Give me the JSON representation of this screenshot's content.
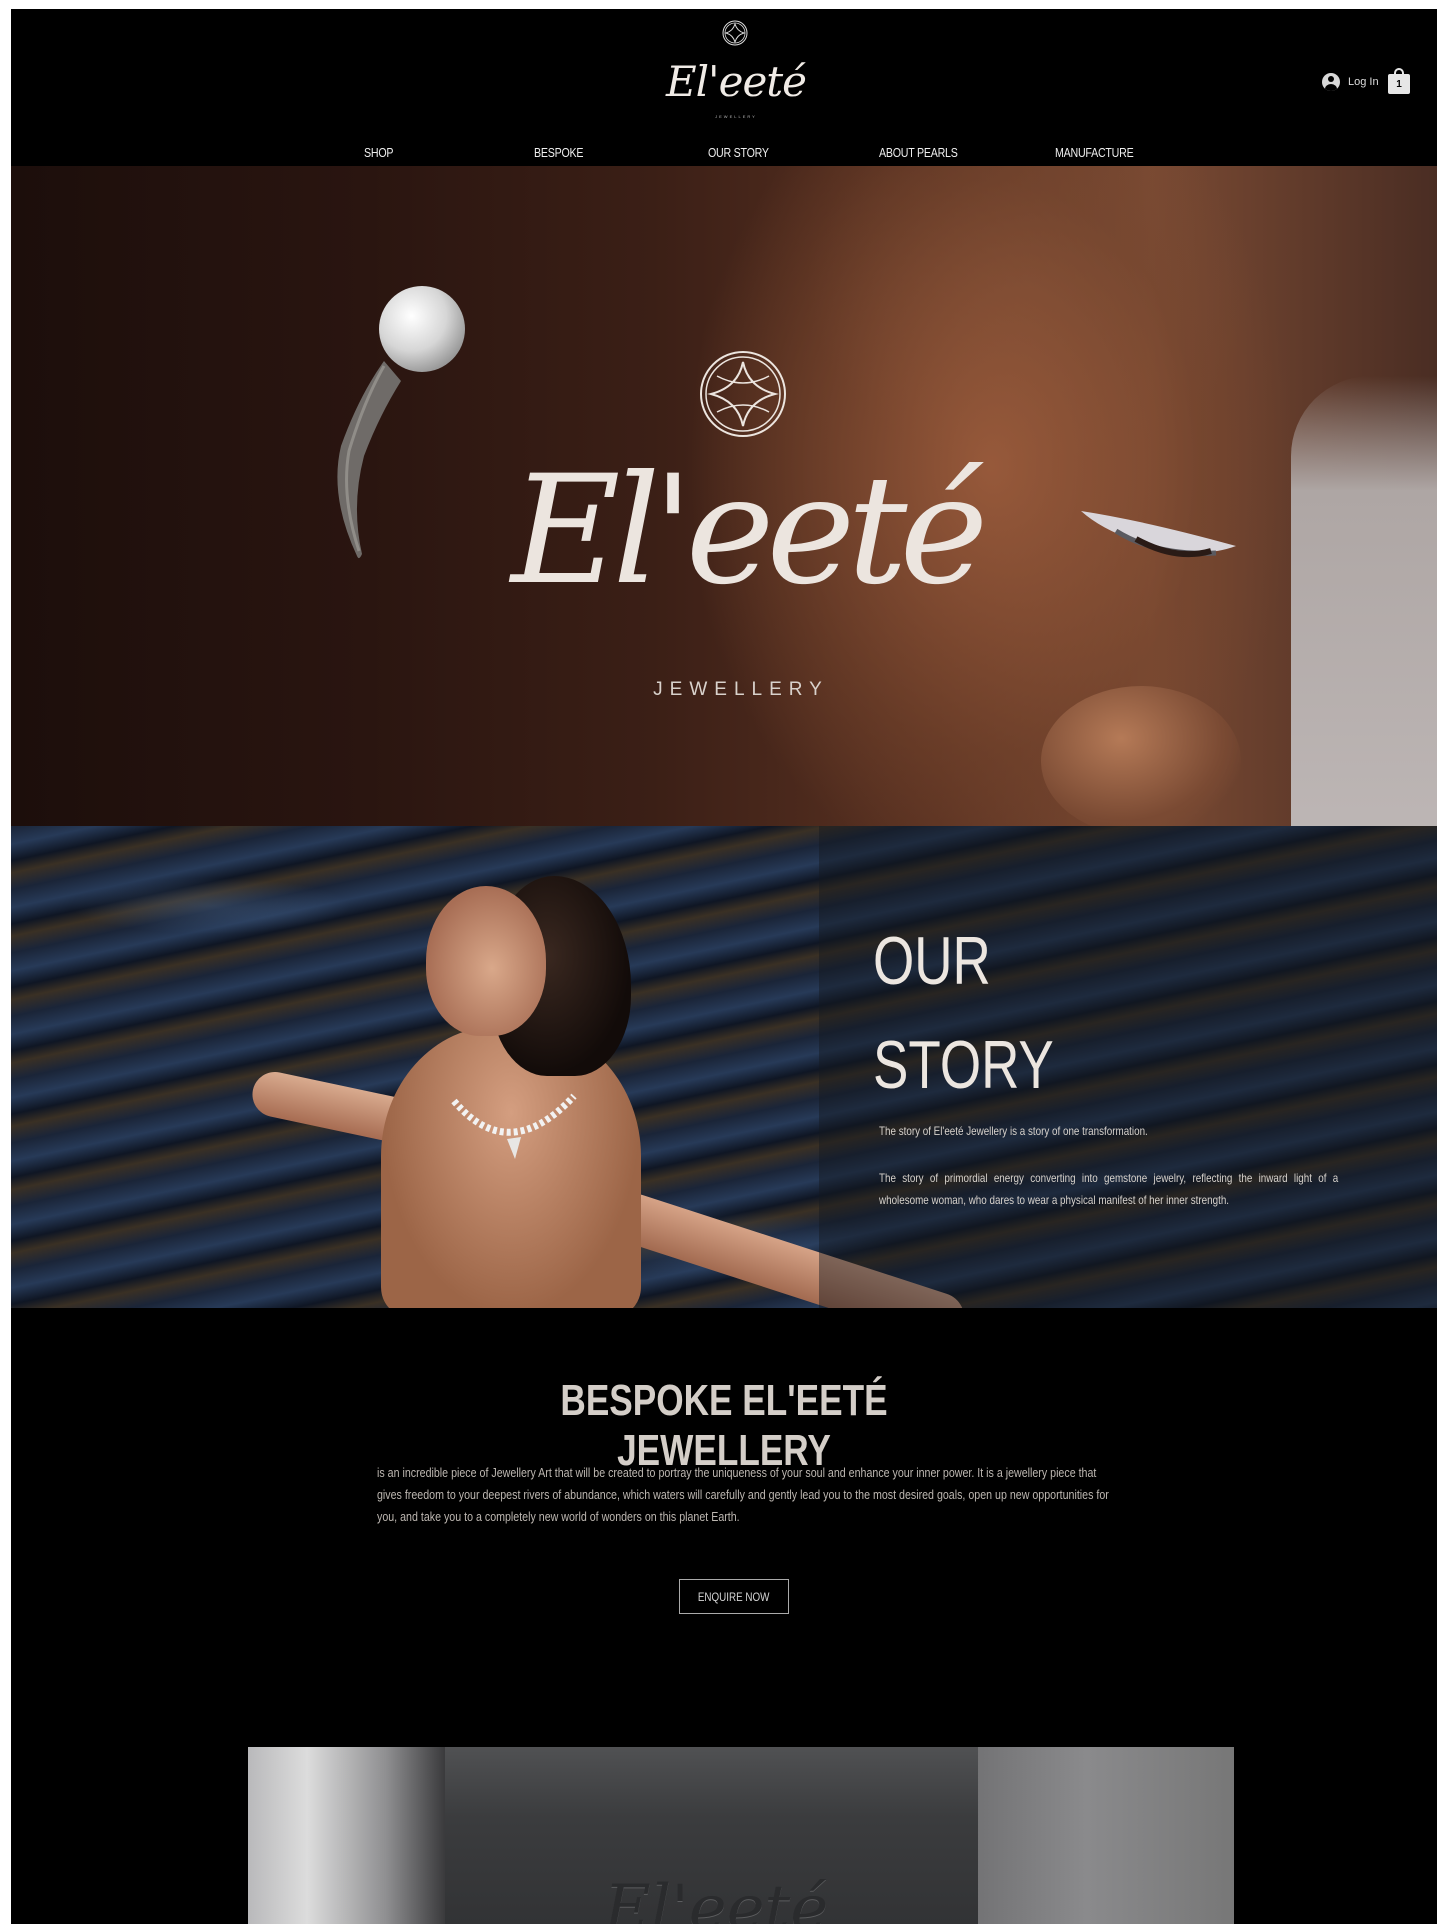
{
  "header": {
    "logo_text": "El'eeté",
    "logo_subtext": "JEWELLERY",
    "login_label": "Log In",
    "cart_count": "1"
  },
  "nav": {
    "items": [
      {
        "label": "SHOP"
      },
      {
        "label": "BESPOKE"
      },
      {
        "label": "OUR STORY"
      },
      {
        "label": "ABOUT PEARLS"
      },
      {
        "label": "MANUFACTURE"
      }
    ]
  },
  "hero": {
    "logo_text": "El'eeté",
    "subtitle": "JEWELLERY"
  },
  "story": {
    "title_line1": "OUR",
    "title_line2": "STORY",
    "paragraph1": "The story of El'eeté Jewellery is a story of one transformation.",
    "paragraph2": "The story of primordial energy converting into gemstone jewelry, reflecting the inward light of a wholesome woman, who dares to wear a physical manifest of her inner strength."
  },
  "bespoke": {
    "title": "BESPOKE EL'EETÉ JEWELLERY",
    "text": "is an incredible piece of Jewellery Art that will be created to portray the uniqueness of your soul and enhance your inner power. It is a jewellery piece that gives freedom to your deepest rivers of abundance, which waters will carefully and gently lead you to the most desired goals, open up new opportunities for you, and take you to a completely new world of wonders on this planet Earth.",
    "button_label": "ENQUIRE NOW"
  },
  "box_image": {
    "logo_text": "El'eeté"
  }
}
